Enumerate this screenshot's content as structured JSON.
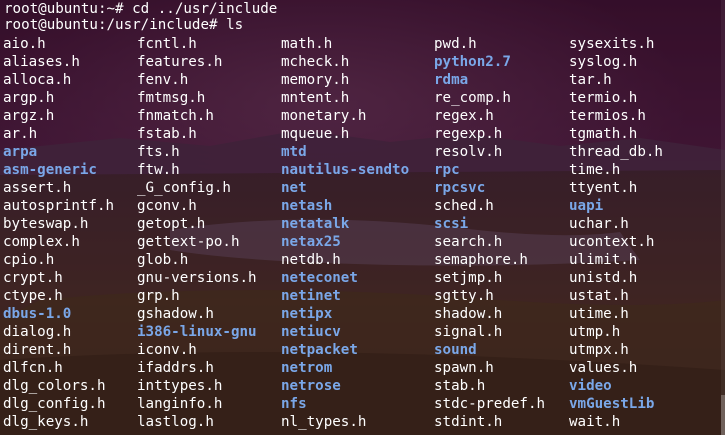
{
  "terminal": {
    "prompts": [
      "root@ubuntu:~# cd ../usr/include",
      "root@ubuntu:/usr/include# ls"
    ],
    "colors": {
      "text": "#ffffff",
      "directory": "#7aa7e8",
      "background": "#2c0a1f"
    },
    "columns": [
      [
        {
          "name": "aio.h"
        },
        {
          "name": "aliases.h"
        },
        {
          "name": "alloca.h"
        },
        {
          "name": "argp.h"
        },
        {
          "name": "argz.h"
        },
        {
          "name": "ar.h"
        },
        {
          "name": "arpa",
          "dir": true
        },
        {
          "name": "asm-generic",
          "dir": true
        },
        {
          "name": "assert.h"
        },
        {
          "name": "autosprintf.h"
        },
        {
          "name": "byteswap.h"
        },
        {
          "name": "complex.h"
        },
        {
          "name": "cpio.h"
        },
        {
          "name": "crypt.h"
        },
        {
          "name": "ctype.h"
        },
        {
          "name": "dbus-1.0",
          "dir": true
        },
        {
          "name": "dialog.h"
        },
        {
          "name": "dirent.h"
        },
        {
          "name": "dlfcn.h"
        },
        {
          "name": "dlg_colors.h"
        },
        {
          "name": "dlg_config.h"
        },
        {
          "name": "dlg_keys.h"
        }
      ],
      [
        {
          "name": "fcntl.h"
        },
        {
          "name": "features.h"
        },
        {
          "name": "fenv.h"
        },
        {
          "name": "fmtmsg.h"
        },
        {
          "name": "fnmatch.h"
        },
        {
          "name": "fstab.h"
        },
        {
          "name": "fts.h"
        },
        {
          "name": "ftw.h"
        },
        {
          "name": "_G_config.h"
        },
        {
          "name": "gconv.h"
        },
        {
          "name": "getopt.h"
        },
        {
          "name": "gettext-po.h"
        },
        {
          "name": "glob.h"
        },
        {
          "name": "gnu-versions.h"
        },
        {
          "name": "grp.h"
        },
        {
          "name": "gshadow.h"
        },
        {
          "name": "i386-linux-gnu",
          "dir": true
        },
        {
          "name": "iconv.h"
        },
        {
          "name": "ifaddrs.h"
        },
        {
          "name": "inttypes.h"
        },
        {
          "name": "langinfo.h"
        },
        {
          "name": "lastlog.h"
        }
      ],
      [
        {
          "name": "math.h"
        },
        {
          "name": "mcheck.h"
        },
        {
          "name": "memory.h"
        },
        {
          "name": "mntent.h"
        },
        {
          "name": "monetary.h"
        },
        {
          "name": "mqueue.h"
        },
        {
          "name": "mtd",
          "dir": true
        },
        {
          "name": "nautilus-sendto",
          "dir": true
        },
        {
          "name": "net",
          "dir": true
        },
        {
          "name": "netash",
          "dir": true
        },
        {
          "name": "netatalk",
          "dir": true
        },
        {
          "name": "netax25",
          "dir": true
        },
        {
          "name": "netdb.h"
        },
        {
          "name": "neteconet",
          "dir": true
        },
        {
          "name": "netinet",
          "dir": true
        },
        {
          "name": "netipx",
          "dir": true
        },
        {
          "name": "netiucv",
          "dir": true
        },
        {
          "name": "netpacket",
          "dir": true
        },
        {
          "name": "netrom",
          "dir": true
        },
        {
          "name": "netrose",
          "dir": true
        },
        {
          "name": "nfs",
          "dir": true
        },
        {
          "name": "nl_types.h"
        }
      ],
      [
        {
          "name": "pwd.h"
        },
        {
          "name": "python2.7",
          "dir": true
        },
        {
          "name": "rdma",
          "dir": true
        },
        {
          "name": "re_comp.h"
        },
        {
          "name": "regex.h"
        },
        {
          "name": "regexp.h"
        },
        {
          "name": "resolv.h"
        },
        {
          "name": "rpc",
          "dir": true
        },
        {
          "name": "rpcsvc",
          "dir": true
        },
        {
          "name": "sched.h"
        },
        {
          "name": "scsi",
          "dir": true
        },
        {
          "name": "search.h"
        },
        {
          "name": "semaphore.h"
        },
        {
          "name": "setjmp.h"
        },
        {
          "name": "sgtty.h"
        },
        {
          "name": "shadow.h"
        },
        {
          "name": "signal.h"
        },
        {
          "name": "sound",
          "dir": true
        },
        {
          "name": "spawn.h"
        },
        {
          "name": "stab.h"
        },
        {
          "name": "stdc-predef.h"
        },
        {
          "name": "stdint.h"
        }
      ],
      [
        {
          "name": "sysexits.h"
        },
        {
          "name": "syslog.h"
        },
        {
          "name": "tar.h"
        },
        {
          "name": "termio.h"
        },
        {
          "name": "termios.h"
        },
        {
          "name": "tgmath.h"
        },
        {
          "name": "thread_db.h"
        },
        {
          "name": "time.h"
        },
        {
          "name": "ttyent.h"
        },
        {
          "name": "uapi",
          "dir": true
        },
        {
          "name": "uchar.h"
        },
        {
          "name": "ucontext.h"
        },
        {
          "name": "ulimit.h"
        },
        {
          "name": "unistd.h"
        },
        {
          "name": "ustat.h"
        },
        {
          "name": "utime.h"
        },
        {
          "name": "utmp.h"
        },
        {
          "name": "utmpx.h"
        },
        {
          "name": "values.h"
        },
        {
          "name": "video",
          "dir": true
        },
        {
          "name": "vmGuestLib",
          "dir": true
        },
        {
          "name": "wait.h"
        }
      ]
    ]
  }
}
